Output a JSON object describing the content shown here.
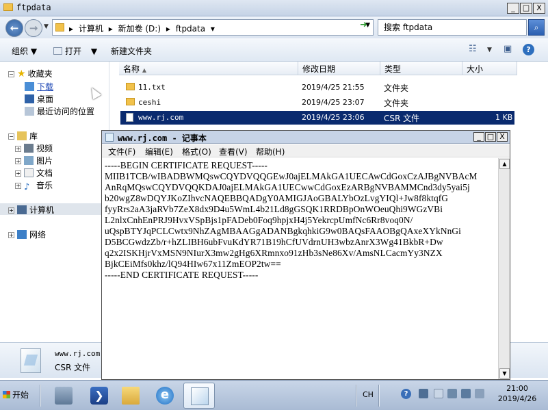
{
  "explorer": {
    "title": "ftpdata",
    "window_controls": [
      "_",
      "□",
      "X"
    ],
    "address_crumbs": [
      "计算机",
      "新加卷 (D:)",
      "ftpdata"
    ],
    "search_placeholder": "搜索 ftpdata",
    "toolbar": {
      "organize": "组织",
      "open": "打开",
      "new_folder": "新建文件夹"
    },
    "nav": {
      "favorites": "收藏夹",
      "downloads": "下载",
      "desktop": "桌面",
      "recent": "最近访问的位置",
      "libraries": "库",
      "videos": "视频",
      "pictures": "图片",
      "documents": "文档",
      "music": "音乐",
      "computer": "计算机",
      "network": "网络"
    },
    "columns": {
      "name": "名称",
      "date": "修改日期",
      "type": "类型",
      "size": "大小"
    },
    "files": [
      {
        "name": "11.txt",
        "date": "2019/4/25 21:55",
        "type": "文件夹",
        "size": "",
        "icon": "folder-icon"
      },
      {
        "name": "ceshi",
        "date": "2019/4/25 23:07",
        "type": "文件夹",
        "size": "",
        "icon": "folder-icon"
      },
      {
        "name": "www.rj.com",
        "date": "2019/4/25 23:06",
        "type": "CSR 文件",
        "size": "1 KB",
        "icon": "document-icon"
      }
    ],
    "details": {
      "name": "www.rj.com",
      "type": "CSR 文件"
    }
  },
  "notepad": {
    "title": "www.rj.com - 记事本",
    "window_controls": [
      "_",
      "□",
      "X"
    ],
    "menu": [
      "文件(F)",
      "编辑(E)",
      "格式(O)",
      "查看(V)",
      "帮助(H)"
    ],
    "content": "-----BEGIN CERTIFICATE REQUEST-----\nMIIB1TCB/wIBADBWMQswCQYDVQQGEwJ0ajELMAkGA1UECAwCdGoxCzAJBgNVBAcM\nAnRqMQswCQYDVQQKDAJ0ajELMAkGA1UECwwCdGoxEzARBgNVBAMMCnd3dy5yai5j\nb20wgZ8wDQYJKoZIhvcNAQEBBQADgY0AMIGJAoGBALYbOzLvgYIQl+Jw8f8ktqfG\nfyyRrs2aA3jaRVb7ZeX8dx9D4u5WmL4b21Ld8gGSQK1RRDBpOnWOeuQhi9WGzVBi\nL2nlxCnhEnPRJ9HvxVSpBjs1pFADeb0Foq9hpjxH4j5YekrcpUmfNc6Rr8voq0N/\nuQspBTYJqPCLCwtx9NhZAgMBAAGgADANBgkqhkiG9w0BAQsFAAOBgQAxeXYkNnGi\nD5BCGwdzZb/r+hZLIBH6ubFvuKdYR71B19hCfUVdrnUH3wbzAnrX3Wg41BkbR+Dw\nq2x2ISKHjrVxMSN9NIurX3mw2gHg6XRmnxo91zHb3sNe86Xv/AmsNLCacmYy3NZX\nBjkCEiMfs0khz/lQ94HIw67x11ZmEOP2tw==\n-----END CERTIFICATE REQUEST-----"
  },
  "taskbar": {
    "start": "开始",
    "lang": "CH",
    "help": "?",
    "time": "21:00",
    "date": "2019/4/26"
  }
}
